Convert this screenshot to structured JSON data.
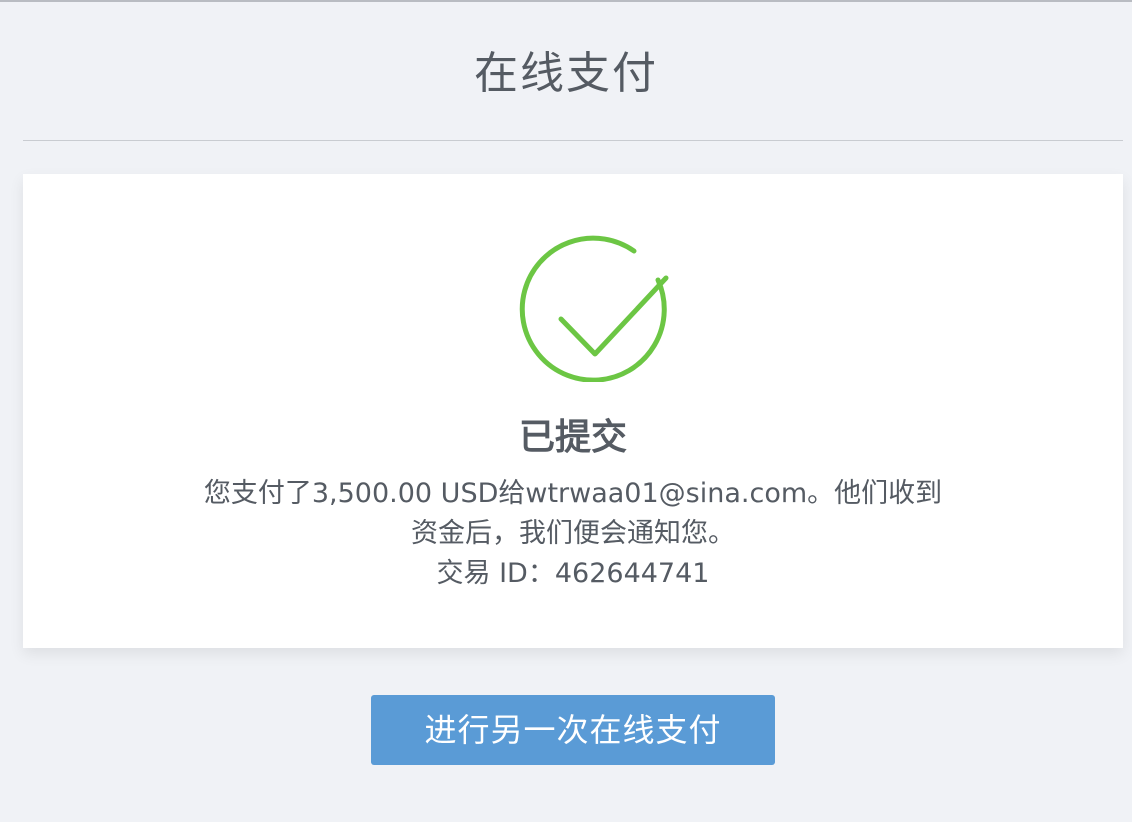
{
  "page": {
    "title": "在线支付"
  },
  "result": {
    "icon": "check-circle-icon",
    "accent_color": "#6cc644",
    "heading": "已提交",
    "message": "您支付了3,500.00 USD给wtrwaa01@sina.com。他们收到资金后，我们便会通知您。",
    "transaction_label": "交易 ID：",
    "transaction_id": "462644741"
  },
  "actions": {
    "again_label": "进行另一次在线支付",
    "button_color": "#5a9bd6"
  }
}
